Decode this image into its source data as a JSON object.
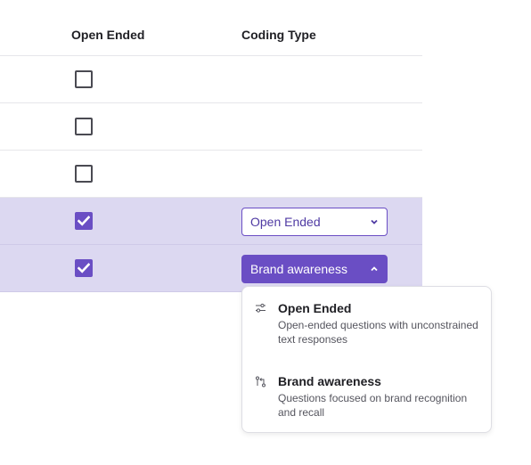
{
  "table": {
    "headers": {
      "open_ended": "Open Ended",
      "coding_type": "Coding Type"
    },
    "rows": [
      {
        "open_ended_checked": false,
        "selected": false
      },
      {
        "open_ended_checked": false,
        "selected": false
      },
      {
        "open_ended_checked": false,
        "selected": false
      },
      {
        "open_ended_checked": true,
        "selected": true,
        "coding_type": "Open Ended",
        "dropdown_open": false
      },
      {
        "open_ended_checked": true,
        "selected": true,
        "coding_type": "Brand awareness",
        "dropdown_open": true
      }
    ]
  },
  "dropdown_menu": {
    "options": [
      {
        "icon": "sliders-icon",
        "title": "Open Ended",
        "description": "Open-ended questions with unconstrained text responses"
      },
      {
        "icon": "git-compare-icon",
        "title": "Brand awareness",
        "description": "Questions focused on brand recognition and recall"
      }
    ]
  },
  "colors": {
    "accent": "#6a4ec4",
    "selected_row": "#dcd8f1",
    "border": "#e6e6ea"
  }
}
